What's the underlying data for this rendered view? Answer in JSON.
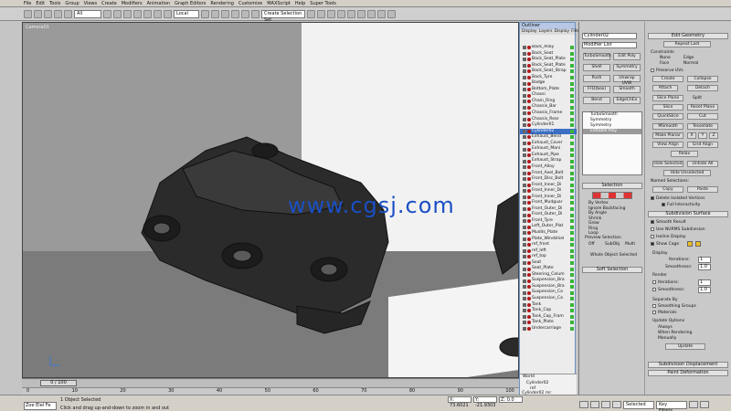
{
  "menu": [
    "File",
    "Edit",
    "Tools",
    "Group",
    "Views",
    "Create",
    "Modifiers",
    "Animation",
    "Graph Editors",
    "Rendering",
    "Customize",
    "MAXScript",
    "Help",
    "Super Tools"
  ],
  "toolbar": {
    "filter": "All",
    "coord": "Local",
    "selection_set": "Create Selection Set"
  },
  "viewport": {
    "label": "Camera01",
    "watermark": "www.cgsj.com"
  },
  "timeline": {
    "frame": "0 / 100"
  },
  "ruler": [
    "0",
    "10",
    "20",
    "30",
    "40",
    "50",
    "60",
    "70",
    "80",
    "90",
    "100"
  ],
  "status": {
    "objects": "1 Object Selected",
    "hint": "Click and drag up-and-down to zoom in and out",
    "script": "Zoe Elel Fe",
    "x": "X: 73.6021",
    "y": "Y: -21.9303",
    "z": "Z: 0.0",
    "selected": "Selected",
    "key_filters": "Key Filters..."
  },
  "outliner": {
    "title": "Outliner",
    "menu": [
      "Display",
      "Layers",
      "Display",
      "Filter"
    ],
    "items": [
      "Back_Alloy",
      "Back_Seat",
      "Back_Seat_Plate",
      "Back_Seat_Plate",
      "Back_Seat_Strap",
      "Back_Tyre",
      "Badge",
      "Bottom_Plate",
      "Chassi",
      "Chain_Ring",
      "Chassis_Bar",
      "Chassis_Frame",
      "Chassis_Rear",
      "Cylinder01",
      "Cylinder02",
      "Exhaust_Bend",
      "Exhaust_Cover",
      "Exhaust_Mani",
      "Exhaust_Pipe",
      "Exhaust_Strap",
      "Front_Alloy",
      "Front_Axel_Bolt",
      "Front_Disc_Bolt",
      "Front_Inner_Di",
      "Front_Inner_Di",
      "Front_Inner_Di",
      "Front_Mudguar",
      "Front_Outer_Di",
      "Front_Outer_Di",
      "Front_Tyre",
      "Left_Outer_Plat",
      "Mudds_Plate",
      "Plate_Windshiel",
      "ref_front",
      "ref_left",
      "ref_top",
      "Seat",
      "Seat_Plate",
      "Steering_Colum",
      "Suspension_Bra",
      "Suspension_Bra",
      "Suspension_Ca",
      "Suspension_Ca",
      "Tank",
      "Tank_Cap",
      "Tank_Cap_Fram",
      "Tank_Plate",
      "Undercarriage"
    ],
    "bottom": [
      "World",
      "Cylinder02",
      "ref"
    ],
    "footer": "Cylinder02 rnr"
  },
  "command_panel": {
    "name": "Cylinder02",
    "modifier_list": "Modifier List",
    "buttons": [
      "TurboSmooth",
      "Edit Poly",
      "Shell",
      "Symmetry",
      "Push",
      "Unwrap UVW",
      "FFD(box)",
      "Smooth",
      "Bend",
      "EdgeChEx"
    ],
    "stack": [
      "TurboSmooth",
      "Symmetry",
      "Symmetry",
      "Editable Poly"
    ],
    "rollouts": {
      "selection": "Selection",
      "soft_selection": "Soft Selection"
    },
    "selection_opts": [
      "By Vertex",
      "Ignore Backfacing",
      "By Angle",
      "Shrink",
      "Grow",
      "Ring",
      "Loop"
    ],
    "preview": {
      "title": "Preview Selection",
      "off": "Off",
      "subobj": "SubObj",
      "multi": "Multi"
    },
    "whole_object": "Whole Object Selected"
  },
  "edit_panel": {
    "title": "Edit Geometry",
    "repeat_last": "Repeat Last",
    "constraints": "Constraints",
    "none": "None",
    "edge": "Edge",
    "face": "Face",
    "normal": "Normal",
    "preserve_uvs": "Preserve UVs",
    "create": "Create",
    "collapse": "Collapse",
    "attach": "Attach",
    "detach": "Detach",
    "slice_plane": "Slice Plane",
    "split": "Split",
    "slice": "Slice",
    "reset_plane": "Reset Plane",
    "quickslice": "QuickSlice",
    "cut": "Cut",
    "msmooth": "MSmooth",
    "tessellate": "Tessellate",
    "make_planar": "Make Planar",
    "xyz": [
      "X",
      "Y",
      "Z"
    ],
    "view_align": "View Align",
    "grid_align": "Grid Align",
    "relax": "Relax",
    "hide_selected": "Hide Selected",
    "unhide_all": "Unhide All",
    "hide_unselected": "Hide Unselected",
    "named_selections": "Named Selections:",
    "copy": "Copy",
    "paste": "Paste",
    "delete_isolated": "Delete Isolated Vertices",
    "full_interactivity": "Full Interactivity",
    "subdivision_surface": "Subdivision Surface",
    "smooth_result": "Smooth Result",
    "use_nurms": "Use NURMS Subdivision",
    "isoline": "Isoline Display",
    "show_cage": "Show Cage",
    "display": "Display",
    "iterations": "Iterations:",
    "smoothness": "Smoothness:",
    "iter_val": "1",
    "smooth_val": "1.0",
    "render": "Render",
    "separate_by": "Separate By",
    "smoothing_groups": "Smoothing Groups",
    "materials": "Materials",
    "update_options": "Update Options",
    "always": "Always",
    "when_rendering": "When Rendering",
    "manually": "Manually",
    "update": "Update",
    "subdivision_displacement": "Subdivision Displacement",
    "paint_deformation": "Paint Deformation"
  }
}
